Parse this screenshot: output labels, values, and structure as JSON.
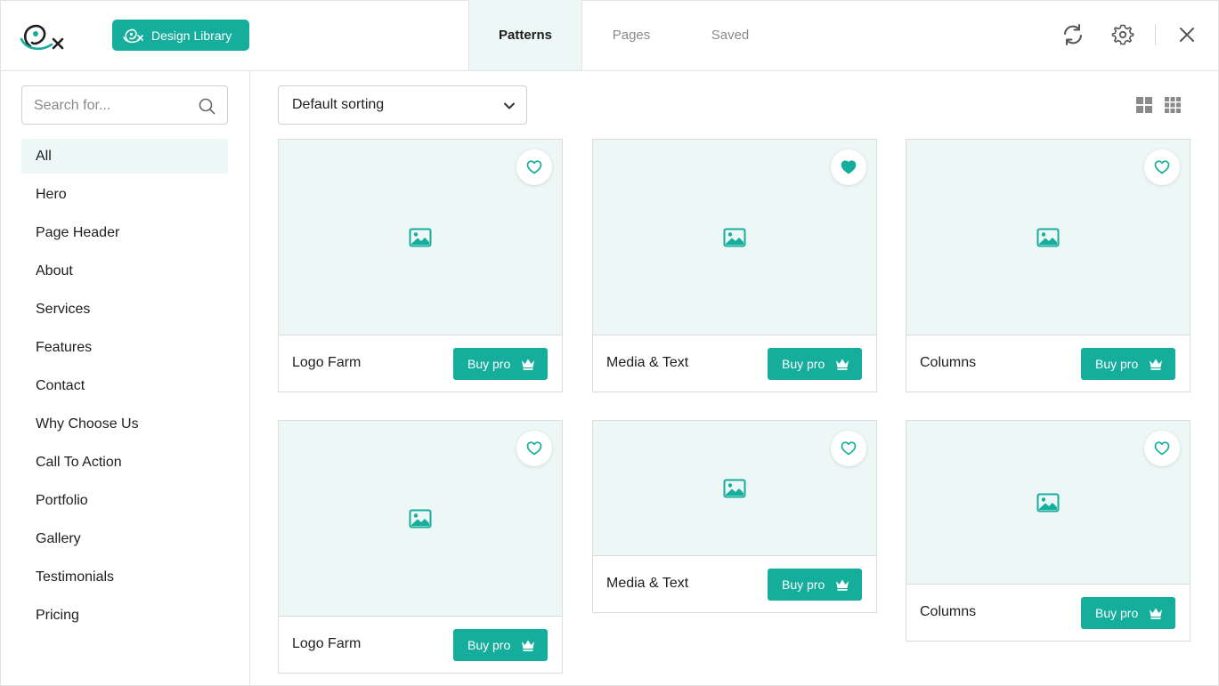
{
  "header": {
    "design_library_label": "Design Library",
    "tabs": [
      {
        "label": "Patterns",
        "active": true
      },
      {
        "label": "Pages",
        "active": false
      },
      {
        "label": "Saved",
        "active": false
      }
    ],
    "icons": [
      "refresh-icon",
      "gear-icon",
      "close-icon"
    ]
  },
  "sidebar": {
    "search_placeholder": "Search for...",
    "categories": [
      {
        "label": "All",
        "active": true
      },
      {
        "label": "Hero"
      },
      {
        "label": "Page Header"
      },
      {
        "label": "About"
      },
      {
        "label": "Services"
      },
      {
        "label": "Features"
      },
      {
        "label": "Contact"
      },
      {
        "label": "Why Choose Us"
      },
      {
        "label": "Call To Action"
      },
      {
        "label": "Portfolio"
      },
      {
        "label": "Gallery"
      },
      {
        "label": "Testimonials"
      },
      {
        "label": "Pricing"
      }
    ]
  },
  "main": {
    "sort_label": "Default sorting",
    "view_options": [
      "grid-large-icon",
      "grid-small-icon"
    ],
    "cards": [
      {
        "title": "Logo Farm",
        "buy_label": "Buy pro",
        "favorited": false
      },
      {
        "title": "Media & Text",
        "buy_label": "Buy pro",
        "favorited": true
      },
      {
        "title": "Columns",
        "buy_label": "Buy pro",
        "favorited": false
      },
      {
        "title": "Logo Farm",
        "buy_label": "Buy pro",
        "favorited": false
      },
      {
        "title": "Media & Text",
        "buy_label": "Buy pro",
        "favorited": false
      },
      {
        "title": "Columns",
        "buy_label": "Buy pro",
        "favorited": false
      }
    ]
  },
  "colors": {
    "accent": "#15ad9c",
    "accent_light": "#edf7f6",
    "border": "#e3e3e3"
  }
}
